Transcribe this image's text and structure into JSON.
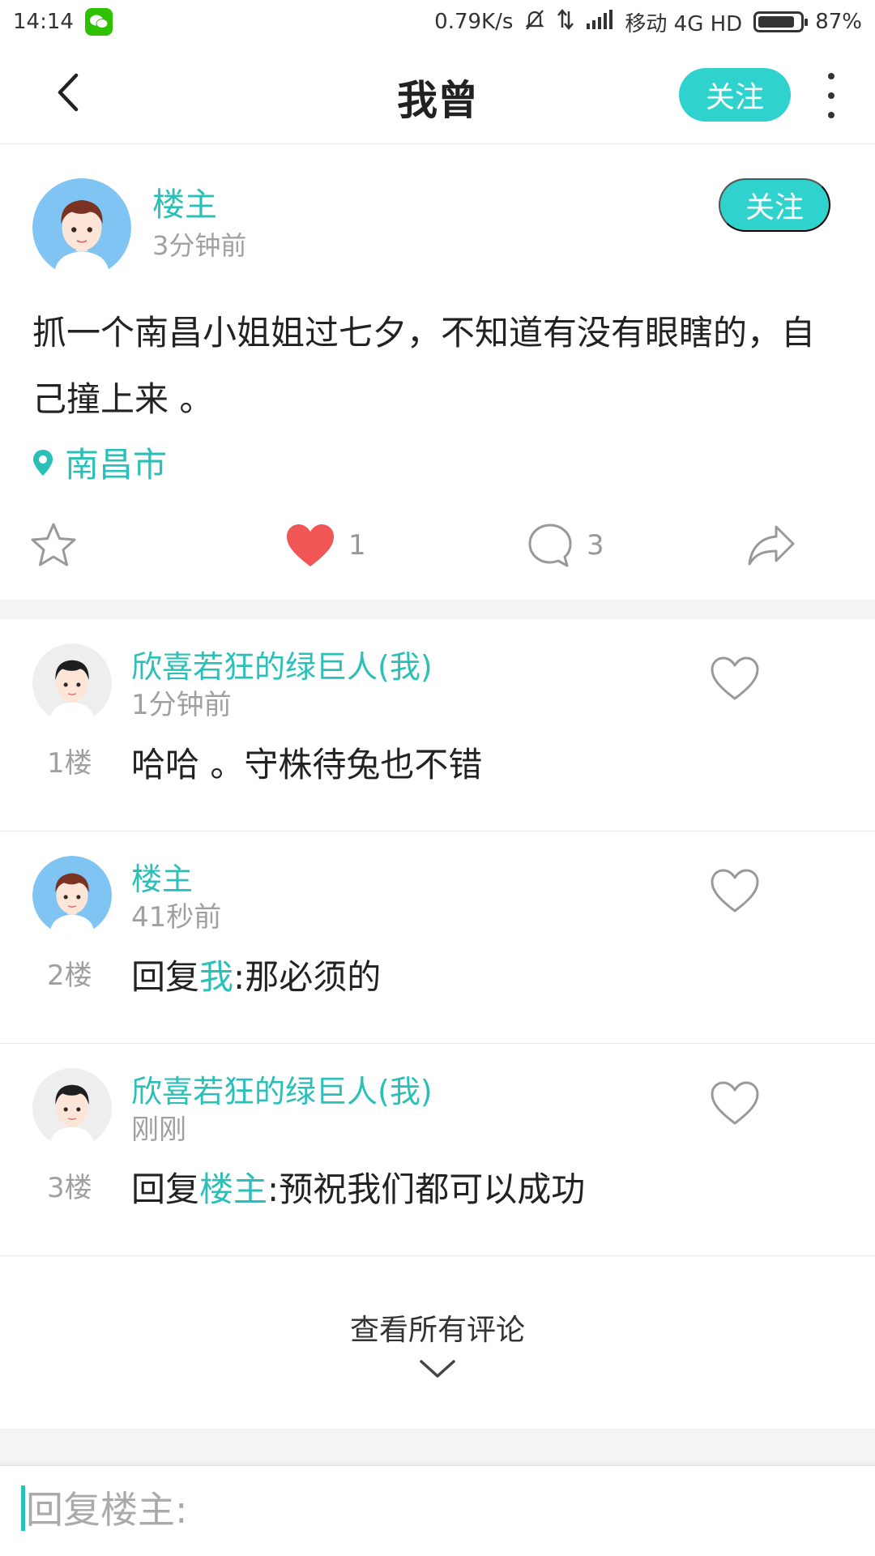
{
  "status_bar": {
    "time": "14:14",
    "network_speed": "0.79K/s",
    "carrier": "移动 4G HD",
    "battery": "87%",
    "battery_level": 0.87
  },
  "header": {
    "title": "我曾",
    "follow_label": "关注"
  },
  "post": {
    "author": "楼主",
    "time": "3分钟前",
    "follow_label": "关注",
    "content": "抓一个南昌小姐姐过七夕，不知道有没有眼瞎的，自己撞上来 。",
    "location": "南昌市",
    "likes": "1",
    "comments": "3"
  },
  "comments": [
    {
      "author": "欣喜若狂的绿巨人(我)",
      "time": "1分钟前",
      "floor": "1楼",
      "reply_prefix": "",
      "reply_target": "",
      "reply_sep": "",
      "text": "哈哈 。守株待兔也不错"
    },
    {
      "author": "楼主",
      "time": "41秒前",
      "floor": "2楼",
      "reply_prefix": "回复",
      "reply_target": "我",
      "reply_sep": ":",
      "text": "那必须的"
    },
    {
      "author": "欣喜若狂的绿巨人(我)",
      "time": "刚刚",
      "floor": "3楼",
      "reply_prefix": "回复",
      "reply_target": "楼主",
      "reply_sep": ":",
      "text": "预祝我们都可以成功"
    }
  ],
  "view_all_label": "查看所有评论",
  "reply_bar": {
    "placeholder": "回复楼主:"
  },
  "colors": {
    "accent": "#2fd2cc",
    "name_teal": "#2bc0b7",
    "like_red": "#f05656",
    "muted": "#a0a0a0"
  }
}
